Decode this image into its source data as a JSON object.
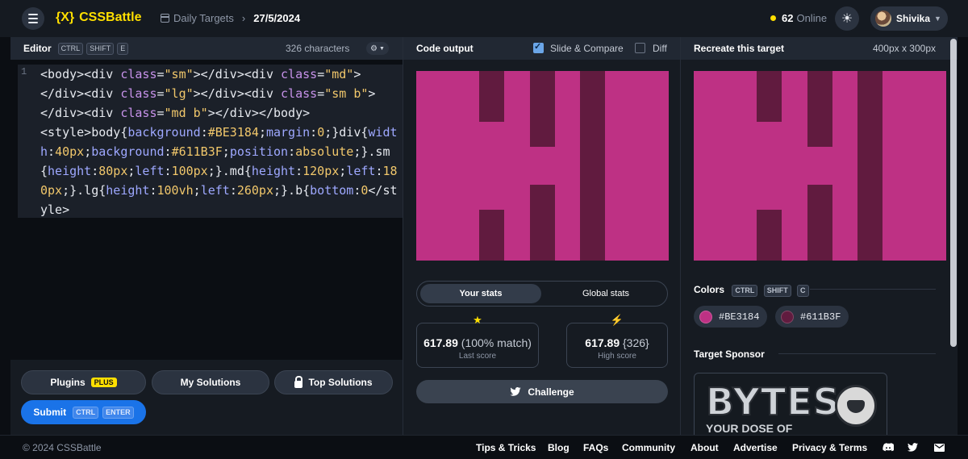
{
  "header": {
    "logo_mark": "{X}",
    "logo_text": "CSSBattle",
    "crumb_label": "Daily Targets",
    "crumb_sep": "›",
    "crumb_date": "27/5/2024",
    "online_count": "62",
    "online_label": "Online",
    "user_name": "Shivika"
  },
  "editor": {
    "title": "Editor",
    "shortcut": [
      "CTRL",
      "SHIFT",
      "E"
    ],
    "char_count": "326 characters",
    "line_number": "1",
    "code": [
      {
        "t": "<body><div ",
        "c": "tag"
      },
      {
        "t": "class",
        "c": "attr"
      },
      {
        "t": "=",
        "c": "tag"
      },
      {
        "t": "\"sm\"",
        "c": "str"
      },
      {
        "t": "></div><div ",
        "c": "tag"
      },
      {
        "t": "class",
        "c": "attr"
      },
      {
        "t": "=",
        "c": "tag"
      },
      {
        "t": "\"md\"",
        "c": "str"
      },
      {
        "t": ">\n</div><div ",
        "c": "tag"
      },
      {
        "t": "class",
        "c": "attr"
      },
      {
        "t": "=",
        "c": "tag"
      },
      {
        "t": "\"lg\"",
        "c": "str"
      },
      {
        "t": "></div><div ",
        "c": "tag"
      },
      {
        "t": "class",
        "c": "attr"
      },
      {
        "t": "=",
        "c": "tag"
      },
      {
        "t": "\"sm b\"",
        "c": "str"
      },
      {
        "t": ">\n</div><div ",
        "c": "tag"
      },
      {
        "t": "class",
        "c": "attr"
      },
      {
        "t": "=",
        "c": "tag"
      },
      {
        "t": "\"md b\"",
        "c": "str"
      },
      {
        "t": "></div></body>\n<style>body{",
        "c": "tag"
      },
      {
        "t": "background",
        "c": "prop"
      },
      {
        "t": ":",
        "c": "tag"
      },
      {
        "t": "#BE3184",
        "c": "val"
      },
      {
        "t": ";",
        "c": "tag"
      },
      {
        "t": "margin",
        "c": "prop"
      },
      {
        "t": ":",
        "c": "tag"
      },
      {
        "t": "0",
        "c": "val"
      },
      {
        "t": ";}div{",
        "c": "tag"
      },
      {
        "t": "width",
        "c": "prop"
      },
      {
        "t": ":",
        "c": "tag"
      },
      {
        "t": "40px",
        "c": "val"
      },
      {
        "t": ";",
        "c": "tag"
      },
      {
        "t": "background",
        "c": "prop"
      },
      {
        "t": ":",
        "c": "tag"
      },
      {
        "t": "#611B3F",
        "c": "val"
      },
      {
        "t": ";",
        "c": "tag"
      },
      {
        "t": "position",
        "c": "prop"
      },
      {
        "t": ":",
        "c": "tag"
      },
      {
        "t": "absolute",
        "c": "val"
      },
      {
        "t": ";}.sm{",
        "c": "tag"
      },
      {
        "t": "height",
        "c": "prop"
      },
      {
        "t": ":",
        "c": "tag"
      },
      {
        "t": "80px",
        "c": "val"
      },
      {
        "t": ";",
        "c": "tag"
      },
      {
        "t": "left",
        "c": "prop"
      },
      {
        "t": ":",
        "c": "tag"
      },
      {
        "t": "100px",
        "c": "val"
      },
      {
        "t": ";}.md{",
        "c": "tag"
      },
      {
        "t": "height",
        "c": "prop"
      },
      {
        "t": ":",
        "c": "tag"
      },
      {
        "t": "120px",
        "c": "val"
      },
      {
        "t": ";",
        "c": "tag"
      },
      {
        "t": "left",
        "c": "prop"
      },
      {
        "t": ":",
        "c": "tag"
      },
      {
        "t": "180px",
        "c": "val"
      },
      {
        "t": ";}.lg{",
        "c": "tag"
      },
      {
        "t": "height",
        "c": "prop"
      },
      {
        "t": ":",
        "c": "tag"
      },
      {
        "t": "100vh",
        "c": "val"
      },
      {
        "t": ";",
        "c": "tag"
      },
      {
        "t": "left",
        "c": "prop"
      },
      {
        "t": ":",
        "c": "tag"
      },
      {
        "t": "260px",
        "c": "val"
      },
      {
        "t": ";}.b{",
        "c": "tag"
      },
      {
        "t": "bottom",
        "c": "prop"
      },
      {
        "t": ":",
        "c": "tag"
      },
      {
        "t": "0",
        "c": "val"
      },
      {
        "t": "</style>",
        "c": "tag"
      }
    ],
    "plugins_label": "Plugins",
    "plugins_badge": "PLUS",
    "my_solutions_label": "My Solutions",
    "top_solutions_label": "Top Solutions",
    "submit_label": "Submit",
    "submit_shortcut": [
      "CTRL",
      "ENTER"
    ]
  },
  "output": {
    "title": "Code output",
    "slide_compare_label": "Slide & Compare",
    "slide_compare_checked": true,
    "diff_label": "Diff",
    "diff_checked": false,
    "tab_your_stats": "Your stats",
    "tab_global_stats": "Global stats",
    "last_score_value": "617.89",
    "last_score_match": "(100% match)",
    "last_score_label": "Last score",
    "high_score_value": "617.89",
    "high_score_chars": "{326}",
    "high_score_label": "High score",
    "challenge_label": "Challenge"
  },
  "target": {
    "title": "Recreate this target",
    "size": "400px x 300px",
    "colors_label": "Colors",
    "colors_shortcut": [
      "CTRL",
      "SHIFT",
      "C"
    ],
    "colors": [
      {
        "hex": "#BE3184"
      },
      {
        "hex": "#611B3F"
      }
    ],
    "sponsor_label": "Target Sponsor",
    "sponsor_title": "BYTES",
    "sponsor_tagline": "YOUR      DOSE OF"
  },
  "colors": {
    "background": "#BE3184",
    "bar": "#611B3F",
    "accent": "#FFDF00",
    "submit": "#1A73E8"
  },
  "footer": {
    "copyright": "© 2024 CSSBattle",
    "links": [
      "Tips & Tricks",
      "Blog",
      "FAQs",
      "Community",
      "About",
      "Advertise",
      "Privacy & Terms"
    ]
  }
}
